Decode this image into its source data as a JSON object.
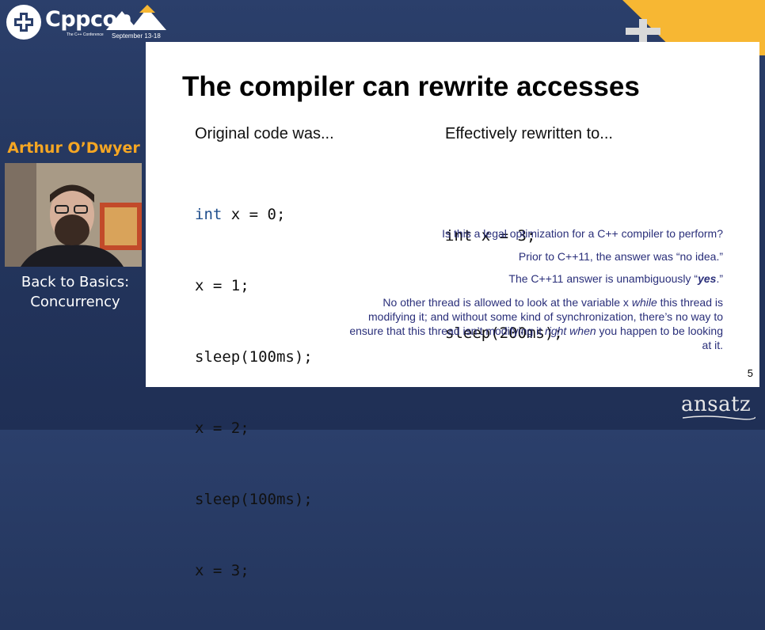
{
  "branding": {
    "logo_text": "Cppcon",
    "logo_subtitle": "The C++ Conference",
    "dates": "September 13-18",
    "watermark": "ansatz"
  },
  "speaker": {
    "name": "Arthur O’Dwyer",
    "talk_title_line1": "Back to Basics:",
    "talk_title_line2": "Concurrency"
  },
  "slide": {
    "title": "The compiler can rewrite accesses",
    "left_heading": "Original code was...",
    "right_heading": "Effectively rewritten to...",
    "left_code": [
      {
        "kw": "int",
        "rest": " x = 0;"
      },
      {
        "kw": "",
        "rest": "x = 1;"
      },
      {
        "kw": "",
        "rest": "sleep(100ms);"
      },
      {
        "kw": "",
        "rest": "x = 2;"
      },
      {
        "kw": "",
        "rest": "sleep(100ms);"
      },
      {
        "kw": "",
        "rest": "x = 3;"
      }
    ],
    "right_code": [
      "int x = 3;",
      "sleep(200ms);"
    ],
    "question": "Is this a legal optimization for a C++ compiler to perform?",
    "answer_prior": "Prior to C++11, the answer was “no idea.”",
    "answer_cpp11_pre": "The C++11 answer is unambiguously “",
    "answer_cpp11_yes": "yes",
    "answer_cpp11_post": ".”",
    "explanation": {
      "p1": "No other thread is allowed to look at the variable x ",
      "while": "while",
      "p2": " this thread is modifying it; and without some kind of synchronization, there’s no way to ensure that this thread isn’t modifying it ",
      "right_when": "right when",
      "p3": " you happen to be looking at it."
    },
    "page_number": "5"
  },
  "colors": {
    "background": "#25375f",
    "accent_orange": "#f7b733",
    "speaker_name": "#f5a623",
    "note_text": "#2a2f7a",
    "keyword": "#1f4e8c"
  }
}
